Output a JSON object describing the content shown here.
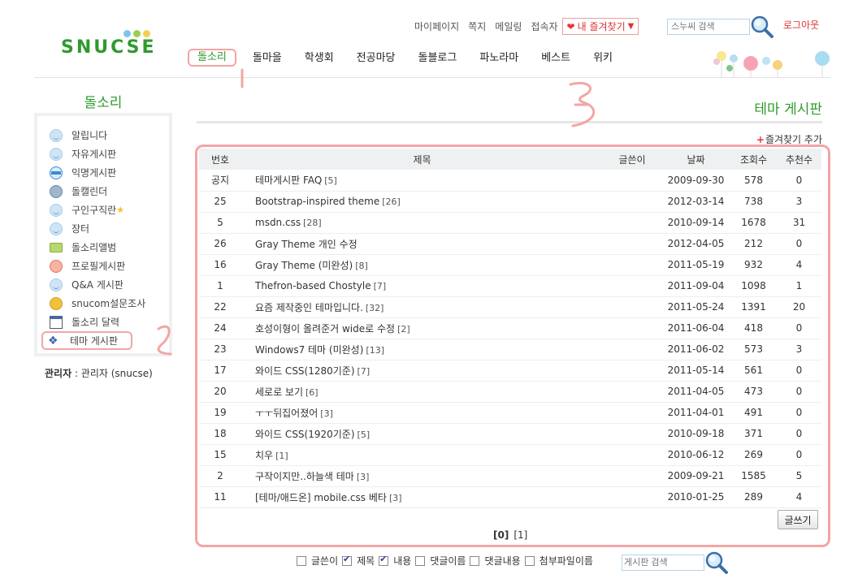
{
  "logo": "SNUCSE",
  "top_links": [
    "마이페이지",
    "쪽지",
    "메일링",
    "접속자"
  ],
  "fav_button": "내 즐겨찾기",
  "search_top_placeholder": "스누씨 검색",
  "logout": "로그아웃",
  "nav": [
    "돌소리",
    "돌마을",
    "학생회",
    "전공마당",
    "돌블로그",
    "파노라마",
    "베스트",
    "위키"
  ],
  "sidebar": {
    "title": "돌소리",
    "items": [
      {
        "label": "알립니다",
        "icon": "smile-icon"
      },
      {
        "label": "자유게시판",
        "icon": "smile-icon"
      },
      {
        "label": "익명게시판",
        "icon": "mask-icon"
      },
      {
        "label": "돌캘린더",
        "icon": "globe-icon"
      },
      {
        "label": "구인구직란",
        "icon": "smile-icon"
      },
      {
        "label": "장터",
        "icon": "smile-icon"
      },
      {
        "label": "돌소리앨범",
        "icon": "camera-icon"
      },
      {
        "label": "프로필게시판",
        "icon": "profile-icon"
      },
      {
        "label": "Q&A 게시판",
        "icon": "smile-icon"
      },
      {
        "label": "snucom설문조사",
        "icon": "moon-icon"
      },
      {
        "label": "돌소리 달력",
        "icon": "calendar-icon"
      },
      {
        "label": "테마 게시판",
        "icon": "diamond-icon"
      }
    ],
    "admin_label": "관리자",
    "admin_value": " : 관리자 (snucse)"
  },
  "page_title": "테마 게시판",
  "fav_add": "즐겨찾기 추가",
  "table": {
    "headers": [
      "번호",
      "제목",
      "글쓴이",
      "날짜",
      "조회수",
      "추천수"
    ],
    "rows": [
      {
        "num": "공지",
        "title": "테마게시판 FAQ",
        "cmt": "[5]",
        "author": "",
        "date": "2009-09-30",
        "views": "578",
        "rec": "0"
      },
      {
        "num": "25",
        "title": "Bootstrap-inspired theme",
        "cmt": "[26]",
        "author": "",
        "date": "2012-03-14",
        "views": "738",
        "rec": "3"
      },
      {
        "num": "5",
        "title": "msdn.css",
        "cmt": "[28]",
        "author": "",
        "date": "2010-09-14",
        "views": "1678",
        "rec": "31"
      },
      {
        "num": "26",
        "title": "Gray Theme 개인 수정",
        "cmt": "",
        "author": "",
        "date": "2012-04-05",
        "views": "212",
        "rec": "0"
      },
      {
        "num": "16",
        "title": "Gray Theme (미완성)",
        "cmt": "[8]",
        "author": "",
        "date": "2011-05-19",
        "views": "932",
        "rec": "4"
      },
      {
        "num": "1",
        "title": "Thefron-based Chostyle",
        "cmt": "[7]",
        "author": "",
        "date": "2011-09-04",
        "views": "1098",
        "rec": "1"
      },
      {
        "num": "22",
        "title": "요즘 제작중인 테마입니다.",
        "cmt": "[32]",
        "author": "",
        "date": "2011-05-24",
        "views": "1391",
        "rec": "20"
      },
      {
        "num": "24",
        "title": "호성이형이 올려준거 wide로 수정",
        "cmt": "[2]",
        "author": "",
        "date": "2011-06-04",
        "views": "418",
        "rec": "0"
      },
      {
        "num": "23",
        "title": "Windows7 테마 (미완성)",
        "cmt": "[13]",
        "author": "",
        "date": "2011-06-02",
        "views": "573",
        "rec": "3"
      },
      {
        "num": "17",
        "title": "와이드 CSS(1280기준)",
        "cmt": "[7]",
        "author": "",
        "date": "2011-05-14",
        "views": "561",
        "rec": "0"
      },
      {
        "num": "20",
        "title": "세로로 보기",
        "cmt": "[6]",
        "author": "",
        "date": "2011-04-05",
        "views": "473",
        "rec": "0"
      },
      {
        "num": "19",
        "title": "ㅜㅜ뒤집어졌어",
        "cmt": "[3]",
        "author": "",
        "date": "2011-04-01",
        "views": "491",
        "rec": "0"
      },
      {
        "num": "18",
        "title": "와이드 CSS(1920기준)",
        "cmt": "[5]",
        "author": "",
        "date": "2010-09-18",
        "views": "371",
        "rec": "0"
      },
      {
        "num": "15",
        "title": "치우",
        "cmt": "[1]",
        "author": "",
        "date": "2010-06-12",
        "views": "269",
        "rec": "0"
      },
      {
        "num": "2",
        "title": "구작이지만..하늘색 테마",
        "cmt": "[3]",
        "author": "",
        "date": "2009-09-21",
        "views": "1585",
        "rec": "5"
      },
      {
        "num": "11",
        "title": "[테마/애드온] mobile.css 베타",
        "cmt": "[3]",
        "author": "",
        "date": "2010-01-25",
        "views": "289",
        "rec": "4"
      }
    ]
  },
  "write_button": "글쓰기",
  "pager": {
    "current": "[0]",
    "next": "[1]"
  },
  "bottom_search": {
    "options": [
      {
        "label": "글쓴이",
        "checked": false
      },
      {
        "label": "제목",
        "checked": true
      },
      {
        "label": "내용",
        "checked": true
      },
      {
        "label": "댓글이름",
        "checked": false
      },
      {
        "label": "댓글내용",
        "checked": false
      },
      {
        "label": "첨부파일이름",
        "checked": false
      }
    ],
    "placeholder": "게시판 검색"
  },
  "colors": {
    "accent_green": "#2f9a2c",
    "highlight_pink": "#f3a5a5",
    "link_red": "#dd3333"
  }
}
